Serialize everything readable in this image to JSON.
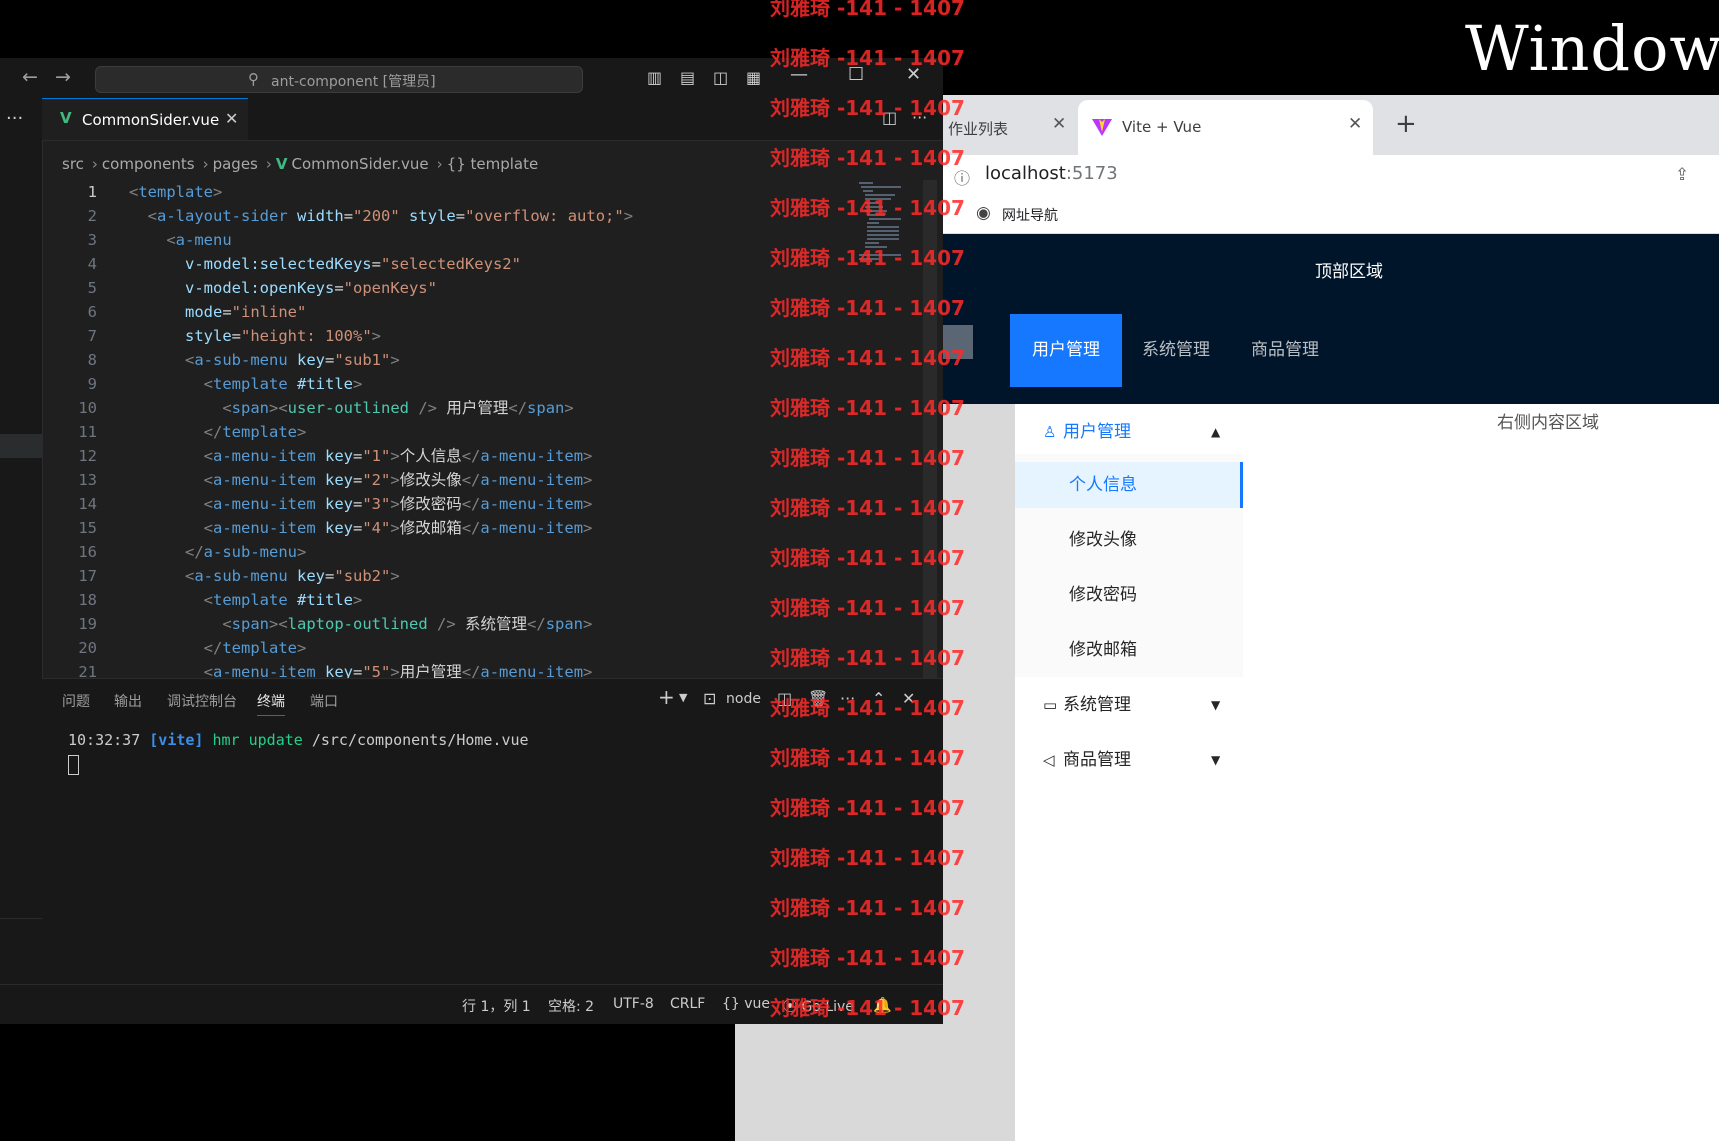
{
  "desktop": {
    "title": "Window"
  },
  "browser": {
    "tabs": [
      {
        "label": "作业列表"
      },
      {
        "label": "Vite + Vue"
      }
    ],
    "url_host": "localhost",
    "url_port": ":5173",
    "bookmarks": [
      {
        "label": "网址导航"
      }
    ]
  },
  "app": {
    "header_title": "顶部区域",
    "nav": [
      "用户管理",
      "系统管理",
      "商品管理"
    ],
    "sider": {
      "submenus": [
        {
          "label": "用户管理",
          "icon": "user-icon",
          "open": true,
          "items": [
            "个人信息",
            "修改头像",
            "修改密码",
            "修改邮箱"
          ]
        },
        {
          "label": "系统管理",
          "icon": "laptop-icon",
          "open": false
        },
        {
          "label": "商品管理",
          "icon": "notification-icon",
          "open": false
        }
      ]
    },
    "content_text": "右侧内容区域"
  },
  "vscode": {
    "search_text": "ant-component [管理员]",
    "tab_label": "CommonSider.vue",
    "breadcrumb": [
      "src",
      "components",
      "pages",
      "CommonSider.vue",
      "{} template"
    ],
    "code_lines": [
      "1",
      "2",
      "3",
      "4",
      "5",
      "6",
      "7",
      "8",
      "9",
      "10",
      "11",
      "12",
      "13",
      "14",
      "15",
      "16",
      "17",
      "18",
      "19",
      "20",
      "21"
    ],
    "code": [
      {
        "indent": "",
        "tokens": [
          [
            "b",
            "<"
          ],
          [
            "tag",
            "template"
          ],
          [
            "b",
            ">"
          ]
        ]
      },
      {
        "indent": "  ",
        "tokens": [
          [
            "b",
            "<"
          ],
          [
            "tag",
            "a-layout-sider"
          ],
          [
            "t",
            " "
          ],
          [
            "attr",
            "width"
          ],
          [
            "t",
            "="
          ],
          [
            "str",
            "\"200\""
          ],
          [
            "t",
            " "
          ],
          [
            "attr",
            "style"
          ],
          [
            "t",
            "="
          ],
          [
            "str",
            "\"overflow: auto;\""
          ],
          [
            "b",
            ">"
          ]
        ]
      },
      {
        "indent": "    ",
        "tokens": [
          [
            "b",
            "<"
          ],
          [
            "tag",
            "a-menu"
          ]
        ]
      },
      {
        "indent": "      ",
        "tokens": [
          [
            "attr",
            "v-model:selectedKeys"
          ],
          [
            "t",
            "="
          ],
          [
            "str",
            "\"selectedKeys2\""
          ]
        ]
      },
      {
        "indent": "      ",
        "tokens": [
          [
            "attr",
            "v-model:openKeys"
          ],
          [
            "t",
            "="
          ],
          [
            "str",
            "\"openKeys\""
          ]
        ]
      },
      {
        "indent": "      ",
        "tokens": [
          [
            "attr",
            "mode"
          ],
          [
            "t",
            "="
          ],
          [
            "str",
            "\"inline\""
          ]
        ]
      },
      {
        "indent": "      ",
        "tokens": [
          [
            "attr",
            "style"
          ],
          [
            "t",
            "="
          ],
          [
            "str",
            "\"height: 100%\""
          ],
          [
            "b",
            ">"
          ]
        ]
      },
      {
        "indent": "      ",
        "tokens": [
          [
            "b",
            "<"
          ],
          [
            "tag",
            "a-sub-menu"
          ],
          [
            "t",
            " "
          ],
          [
            "attr",
            "key"
          ],
          [
            "t",
            "="
          ],
          [
            "str",
            "\"sub1\""
          ],
          [
            "b",
            ">"
          ]
        ]
      },
      {
        "indent": "        ",
        "tokens": [
          [
            "b",
            "<"
          ],
          [
            "tag",
            "template"
          ],
          [
            "t",
            " "
          ],
          [
            "attr",
            "#title"
          ],
          [
            "b",
            ">"
          ]
        ]
      },
      {
        "indent": "          ",
        "tokens": [
          [
            "b",
            "<"
          ],
          [
            "tag",
            "span"
          ],
          [
            "b",
            "><"
          ],
          [
            "cmp",
            "user-outlined"
          ],
          [
            "t",
            " "
          ],
          [
            "b",
            "/>"
          ],
          [
            "t",
            " 用户管理"
          ],
          [
            "b",
            "</"
          ],
          [
            "tag",
            "span"
          ],
          [
            "b",
            ">"
          ]
        ]
      },
      {
        "indent": "        ",
        "tokens": [
          [
            "b",
            "</"
          ],
          [
            "tag",
            "template"
          ],
          [
            "b",
            ">"
          ]
        ]
      },
      {
        "indent": "        ",
        "tokens": [
          [
            "b",
            "<"
          ],
          [
            "tag",
            "a-menu-item"
          ],
          [
            "t",
            " "
          ],
          [
            "attr",
            "key"
          ],
          [
            "t",
            "="
          ],
          [
            "str",
            "\"1\""
          ],
          [
            "b",
            ">"
          ],
          [
            "t",
            "个人信息"
          ],
          [
            "b",
            "</"
          ],
          [
            "tag",
            "a-menu-item"
          ],
          [
            "b",
            ">"
          ]
        ]
      },
      {
        "indent": "        ",
        "tokens": [
          [
            "b",
            "<"
          ],
          [
            "tag",
            "a-menu-item"
          ],
          [
            "t",
            " "
          ],
          [
            "attr",
            "key"
          ],
          [
            "t",
            "="
          ],
          [
            "str",
            "\"2\""
          ],
          [
            "b",
            ">"
          ],
          [
            "t",
            "修改头像"
          ],
          [
            "b",
            "</"
          ],
          [
            "tag",
            "a-menu-item"
          ],
          [
            "b",
            ">"
          ]
        ]
      },
      {
        "indent": "        ",
        "tokens": [
          [
            "b",
            "<"
          ],
          [
            "tag",
            "a-menu-item"
          ],
          [
            "t",
            " "
          ],
          [
            "attr",
            "key"
          ],
          [
            "t",
            "="
          ],
          [
            "str",
            "\"3\""
          ],
          [
            "b",
            ">"
          ],
          [
            "t",
            "修改密码"
          ],
          [
            "b",
            "</"
          ],
          [
            "tag",
            "a-menu-item"
          ],
          [
            "b",
            ">"
          ]
        ]
      },
      {
        "indent": "        ",
        "tokens": [
          [
            "b",
            "<"
          ],
          [
            "tag",
            "a-menu-item"
          ],
          [
            "t",
            " "
          ],
          [
            "attr",
            "key"
          ],
          [
            "t",
            "="
          ],
          [
            "str",
            "\"4\""
          ],
          [
            "b",
            ">"
          ],
          [
            "t",
            "修改邮箱"
          ],
          [
            "b",
            "</"
          ],
          [
            "tag",
            "a-menu-item"
          ],
          [
            "b",
            ">"
          ]
        ]
      },
      {
        "indent": "      ",
        "tokens": [
          [
            "b",
            "</"
          ],
          [
            "tag",
            "a-sub-menu"
          ],
          [
            "b",
            ">"
          ]
        ]
      },
      {
        "indent": "      ",
        "tokens": [
          [
            "b",
            "<"
          ],
          [
            "tag",
            "a-sub-menu"
          ],
          [
            "t",
            " "
          ],
          [
            "attr",
            "key"
          ],
          [
            "t",
            "="
          ],
          [
            "str",
            "\"sub2\""
          ],
          [
            "b",
            ">"
          ]
        ]
      },
      {
        "indent": "        ",
        "tokens": [
          [
            "b",
            "<"
          ],
          [
            "tag",
            "template"
          ],
          [
            "t",
            " "
          ],
          [
            "attr",
            "#title"
          ],
          [
            "b",
            ">"
          ]
        ]
      },
      {
        "indent": "          ",
        "tokens": [
          [
            "b",
            "<"
          ],
          [
            "tag",
            "span"
          ],
          [
            "b",
            "><"
          ],
          [
            "cmp",
            "laptop-outlined"
          ],
          [
            "t",
            " "
          ],
          [
            "b",
            "/>"
          ],
          [
            "t",
            " 系统管理"
          ],
          [
            "b",
            "</"
          ],
          [
            "tag",
            "span"
          ],
          [
            "b",
            ">"
          ]
        ]
      },
      {
        "indent": "        ",
        "tokens": [
          [
            "b",
            "</"
          ],
          [
            "tag",
            "template"
          ],
          [
            "b",
            ">"
          ]
        ]
      },
      {
        "indent": "        ",
        "tokens": [
          [
            "b",
            "<"
          ],
          [
            "tag",
            "a-menu-item"
          ],
          [
            "t",
            " "
          ],
          [
            "attr",
            "key"
          ],
          [
            "t",
            "="
          ],
          [
            "str",
            "\"5\""
          ],
          [
            "b",
            ">"
          ],
          [
            "t",
            "用户管理"
          ],
          [
            "b",
            "</"
          ],
          [
            "tag",
            "a-menu-item"
          ],
          [
            "b",
            ">"
          ]
        ]
      }
    ],
    "panel_tabs": [
      "问题",
      "输出",
      "调试控制台",
      "终端",
      "端口"
    ],
    "active_panel_tab": "终端",
    "terminal_name": "node",
    "terminal": {
      "time": "10:32:37",
      "vite": "[vite]",
      "hmr": "hmr update",
      "path": "/src/components/Home.vue"
    },
    "status": [
      "行 1，列 1",
      "空格: 2",
      "UTF-8",
      "CRLF",
      "{} vue",
      "Go Live"
    ]
  },
  "watermark": {
    "text": "刘雅琦 -141 - 1407"
  },
  "colors": {
    "accent": "#1677ff",
    "header": "#001529",
    "vue_green": "#42b883",
    "watermark": "#ff2a2a"
  }
}
